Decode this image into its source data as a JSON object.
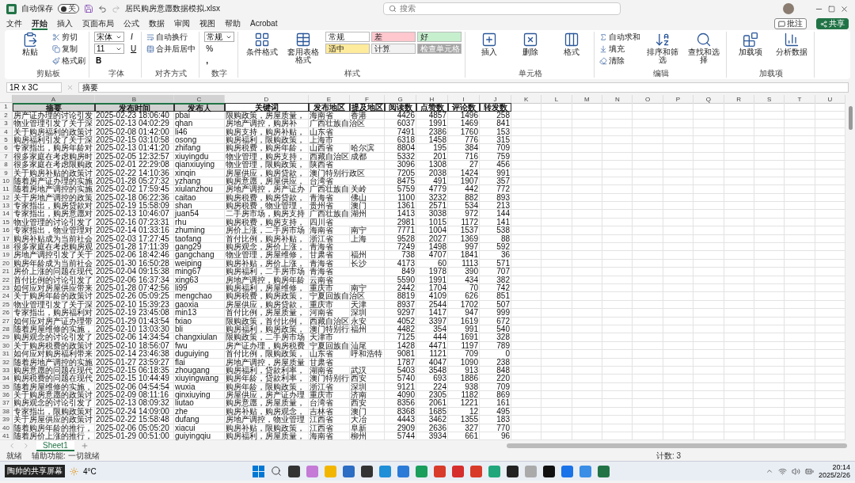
{
  "title_bar": {
    "autosave_label": "自动保存",
    "autosave_on": false,
    "autosave_state": "关",
    "filename": "居民购房意愿数据模拟.xlsx",
    "search_placeholder": "搜索"
  },
  "menu_tabs": [
    {
      "label": "文件",
      "selected": false
    },
    {
      "label": "开始",
      "selected": true
    },
    {
      "label": "插入",
      "selected": false
    },
    {
      "label": "页面布局",
      "selected": false
    },
    {
      "label": "公式",
      "selected": false
    },
    {
      "label": "数据",
      "selected": false
    },
    {
      "label": "审阅",
      "selected": false
    },
    {
      "label": "视图",
      "selected": false
    },
    {
      "label": "帮助",
      "selected": false
    },
    {
      "label": "Acrobat",
      "selected": false
    }
  ],
  "comment_button": "批注",
  "share_button": "共享",
  "ribbon": [
    {
      "title": "剪贴板",
      "items": [
        {
          "kind": "large",
          "label": "粘贴"
        },
        {
          "kind": "small",
          "label": "剪切"
        },
        {
          "kind": "small",
          "label": "复制"
        },
        {
          "kind": "small",
          "label": "格式刷"
        }
      ]
    },
    {
      "title": "字体",
      "items": [
        {
          "kind": "select",
          "value": "宋体"
        },
        {
          "kind": "select",
          "value": "11"
        },
        {
          "kind": "glyph",
          "label": "B"
        },
        {
          "kind": "glyph",
          "label": "I"
        },
        {
          "kind": "glyph",
          "label": "U"
        }
      ]
    },
    {
      "title": "对齐方式",
      "items": [
        {
          "kind": "small",
          "label": "自动换行"
        },
        {
          "kind": "small",
          "label": "合并后居中"
        }
      ]
    },
    {
      "title": "数字",
      "items": [
        {
          "kind": "select",
          "value": "常规"
        },
        {
          "kind": "glyph",
          "label": "%"
        },
        {
          "kind": "glyph",
          "label": ","
        }
      ]
    },
    {
      "title": "样式",
      "items": [
        {
          "kind": "large",
          "label": "条件格式"
        },
        {
          "kind": "large",
          "label": "套用表格格式"
        }
      ],
      "styles": [
        {
          "label": "常规",
          "color": "#ffffff"
        },
        {
          "label": "差",
          "color": "#ffc7ce"
        },
        {
          "label": "好",
          "color": "#c6efce"
        },
        {
          "label": "适中",
          "color": "#ffeb9c"
        },
        {
          "label": "计算",
          "color": "#f2f2f2"
        },
        {
          "label": "检查单元格",
          "color": "#a5a5a5"
        }
      ]
    },
    {
      "title": "单元格",
      "items": [
        {
          "kind": "large",
          "label": "插入"
        },
        {
          "kind": "large",
          "label": "删除"
        },
        {
          "kind": "large",
          "label": "格式"
        }
      ]
    },
    {
      "title": "编辑",
      "items": [
        {
          "kind": "small",
          "label": "自动求和"
        },
        {
          "kind": "small",
          "label": "填充"
        },
        {
          "kind": "small",
          "label": "清除"
        },
        {
          "kind": "large",
          "label": "排序和筛选"
        },
        {
          "kind": "large",
          "label": "查找和选择"
        }
      ]
    },
    {
      "title": "加载项",
      "items": [
        {
          "kind": "large",
          "label": "加载项"
        },
        {
          "kind": "large",
          "label": "分析数据"
        }
      ]
    }
  ],
  "formula_bar": {
    "name_box": "1R x 3C",
    "value": "摘要"
  },
  "sheet": {
    "columns": [
      {
        "label": "A",
        "selected": true
      },
      {
        "label": "B",
        "selected": true
      },
      {
        "label": "C",
        "selected": true
      },
      {
        "label": "D",
        "selected": false
      },
      {
        "label": "E",
        "selected": false
      },
      {
        "label": "F",
        "selected": false
      },
      {
        "label": "G",
        "selected": false
      },
      {
        "label": "H",
        "selected": false
      },
      {
        "label": "I",
        "selected": false
      },
      {
        "label": "J",
        "selected": false
      },
      {
        "label": "K",
        "selected": false
      },
      {
        "label": "L",
        "selected": false
      },
      {
        "label": "M",
        "selected": false
      },
      {
        "label": "N",
        "selected": false
      },
      {
        "label": "O",
        "selected": false
      },
      {
        "label": "P",
        "selected": false
      },
      {
        "label": "Q",
        "selected": false
      },
      {
        "label": "R",
        "selected": false
      },
      {
        "label": "S",
        "selected": false
      },
      {
        "label": "T",
        "selected": false
      },
      {
        "label": "U",
        "selected": false
      }
    ],
    "row_numbers": [
      "1",
      "2",
      "3",
      "4",
      "5",
      "6",
      "7",
      "8",
      "9",
      "10",
      "11",
      "12",
      "13",
      "14",
      "15",
      "16",
      "17",
      "18",
      "19",
      "20",
      "21",
      "22",
      "23",
      "24",
      "25",
      "26",
      "27",
      "28",
      "29",
      "30",
      "31",
      "32",
      "33",
      "34",
      "35",
      "36",
      "37",
      "38",
      "39",
      "40",
      "41"
    ],
    "header": [
      {
        "text": "摘要",
        "selected": true
      },
      {
        "text": "发布时间",
        "selected": true
      },
      {
        "text": "发布人",
        "selected": true
      },
      {
        "text": "关键词",
        "selected": false
      },
      {
        "text": "发布地区",
        "selected": false
      },
      {
        "text": "提及地区",
        "selected": false
      },
      {
        "text": "阅读数",
        "selected": false
      },
      {
        "text": "点赞数",
        "selected": false
      },
      {
        "text": "评论数",
        "selected": false
      },
      {
        "text": "转发数",
        "selected": false
      }
    ],
    "rows": [
      [
        "房产证办理的讨论引发",
        "2025-02-23 18:06:40",
        "pbai",
        "限购政策，房屋质量，",
        "海南省",
        "香港",
        "4426",
        "4857",
        "1496",
        "258"
      ],
      [
        "物业管理引发了关于深",
        "2025-02-13 04:02:29",
        "qhan",
        "房地产调控，购房补",
        "广西壮族自治区",
        "",
        "6037",
        "1991",
        "1469",
        "841"
      ],
      [
        "关于购房福利的政策讨",
        "2025-02-08 01:42:00",
        "li46",
        "购房支持，购房补贴，",
        "山东省",
        "",
        "7491",
        "2386",
        "1760",
        "153"
      ],
      [
        "购房福利引发了关于深",
        "2025-02-15 03:10:58",
        "osong",
        "购房福利，限购政策，",
        "上海市",
        "",
        "6318",
        "1458",
        "776",
        "315"
      ],
      [
        "专家指出，购房年龄对",
        "2025-02-13 01:41:20",
        "zhifang",
        "购房税费，购房年龄，",
        "山西省",
        "哈尔滨",
        "8804",
        "195",
        "384",
        "709"
      ],
      [
        "很多家庭在考虑购房时",
        "2025-02-05 12:32:57",
        "xiuyingdu",
        "物业管理，购房支持，",
        "西藏自治区",
        "成都",
        "5332",
        "201",
        "716",
        "759"
      ],
      [
        "很多家庭在考虑限购政",
        "2025-02-01 22:29:08",
        "qianxiuying",
        "物业管理，限购政策，",
        "陕西省",
        "",
        "3096",
        "1308",
        "27",
        "456"
      ],
      [
        "关于购房补贴的政策讨",
        "2025-02-22 14:10:36",
        "xinqin",
        "房屋供应，购房贷款，",
        "澳门特别行政区",
        "",
        "7205",
        "2038",
        "1424",
        "991"
      ],
      [
        "随着房产证办理的实施",
        "2025-01-28 05:27:32",
        "yzhang",
        "购房意愿，房屋供应，",
        "台湾省",
        "",
        "8475",
        "491",
        "1907",
        "357"
      ],
      [
        "随着房地产调控的实施",
        "2025-02-02 17:59:45",
        "xiulanzhou",
        "房地产调控，房产证办",
        "广西壮族自",
        "关岭",
        "5759",
        "4779",
        "442",
        "772"
      ],
      [
        "关于房地产调控的政策",
        "2025-02-18 06:22:36",
        "caitao",
        "购房税费，购房贷款，",
        "青海省",
        "佛山",
        "1100",
        "3232",
        "882",
        "893"
      ],
      [
        "专家指出，购房贷款对",
        "2025-02-19 15:58:09",
        "shan",
        "购房税费，物业管理，",
        "贵州省",
        "澳门",
        "1361",
        "2571",
        "534",
        "213"
      ],
      [
        "专家指出，购房意愿对",
        "2025-02-13 10:46:07",
        "juan54",
        "二手房市场，购房支持",
        "广西壮族自",
        "湖州",
        "1413",
        "3038",
        "972",
        "144"
      ],
      [
        "物业管理的讨论引发了",
        "2025-02-16 07:23:31",
        "rhu",
        "购房税费，购房支持，",
        "四川省",
        "",
        "2981",
        "1015",
        "1172",
        "141"
      ],
      [
        "专家指出，物业管理对",
        "2025-02-14 01:33:16",
        "zhuming",
        "房价上涨，二手房市场",
        "海南省",
        "南宁",
        "7771",
        "1004",
        "1537",
        "538"
      ],
      [
        "购房补贴成为当前社会",
        "2025-02-03 17:27:45",
        "taofang",
        "首付比例，购房补贴，",
        "浙江省",
        "上海",
        "9528",
        "2027",
        "1369",
        "88"
      ],
      [
        "很多家庭在考虑购房观",
        "2025-01-28 17:11:39",
        "gang29",
        "购房观念，房价上涨，",
        "青海省",
        "",
        "7249",
        "1498",
        "997",
        "592"
      ],
      [
        "房地产调控引发了关于",
        "2025-02-06 18:42:46",
        "gangchang",
        "物业管理，房屋维修，",
        "甘肃省",
        "福州",
        "738",
        "4707",
        "1841",
        "36"
      ],
      [
        "购房年龄成为当前社会",
        "2025-01-30 16:50:28",
        "weiping",
        "购房补贴，房价上涨，",
        "青海省",
        "长沙",
        "4173",
        "60",
        "1113",
        "571"
      ],
      [
        "房价上涨的问题在现代",
        "2025-02-04 09:15:38",
        "ming67",
        "购房福利，二手房市场",
        "青海省",
        "",
        "849",
        "1978",
        "390",
        "707"
      ],
      [
        "首付比例的讨论引发了",
        "2025-02-06 16:37:34",
        "xing63",
        "房地产调控，购房年龄",
        "云南省",
        "",
        "5590",
        "1991",
        "434",
        "382"
      ],
      [
        "如何应对房屋供应带来",
        "2025-01-28 07:42:56",
        "li99",
        "购房福利，房屋维修，",
        "重庆市",
        "南宁",
        "2442",
        "1704",
        "70",
        "742"
      ],
      [
        "关于购房年龄的政策讨",
        "2025-02-26 05:09:25",
        "mengchao",
        "购房税费，购房政策，",
        "宁夏回族自治区",
        "",
        "8819",
        "4109",
        "626",
        "851"
      ],
      [
        "物业管理引发了关于深",
        "2025-02-10 15:39:23",
        "gaoxia",
        "房屋供应，购房贷款，",
        "重庆市",
        "天津",
        "8937",
        "2544",
        "1702",
        "507"
      ],
      [
        "专家指出，购房福利对",
        "2025-02-19 23:45:08",
        "min13",
        "首付比例，房屋质量，",
        "河南省",
        "深圳",
        "9297",
        "1417",
        "947",
        "999"
      ],
      [
        "如何应对房产证办理带",
        "2025-01-29 01:43:54",
        "fxiao",
        "限购政策，首付比例，",
        "西藏自治区",
        "永安",
        "4052",
        "3397",
        "1619",
        "672"
      ],
      [
        "随着房屋维修的实施，",
        "2025-02-10 13:03:30",
        "bli",
        "购房福利，购房政策，",
        "澳门特别行",
        "福州",
        "4482",
        "354",
        "991",
        "540"
      ],
      [
        "购房观念的讨论引发了",
        "2025-02-06 14:34:54",
        "changxiulan",
        "限购政策，二手房市场",
        "天津市",
        "",
        "7125",
        "444",
        "1691",
        "328"
      ],
      [
        "关于购房税费的政策讨",
        "2025-02-10 18:56:07",
        "fwu",
        "房产证办理，购房税费",
        "宁夏回族自",
        "汕尾",
        "1428",
        "4471",
        "1197",
        "789"
      ],
      [
        "如何应对购房福利带来",
        "2025-02-14 23:46:38",
        "duguiying",
        "首付比例，限购政策，",
        "山东省",
        "呼和浩特",
        "9081",
        "1121",
        "709",
        "0"
      ],
      [
        "随着房地产调控的实施",
        "2025-01-27 23:59:27",
        "flai",
        "房地产调控，房屋质量",
        "甘肃省",
        "",
        "1787",
        "4047",
        "1090",
        "238"
      ],
      [
        "购房意愿的问题在现代",
        "2025-02-15 06:18:35",
        "zhougang",
        "购房福利，贷款利率，",
        "湖南省",
        "武汉",
        "5403",
        "3548",
        "913",
        "848"
      ],
      [
        "购房税费的问题在现代",
        "2025-02-15 10:44:49",
        "xiuyingwang",
        "购房年龄，贷款利率，",
        "澳门特别行",
        "西安",
        "5740",
        "693",
        "1886",
        "220"
      ],
      [
        "随着房屋维修的实施，",
        "2025-02-06 04:54:54",
        "wuxia",
        "购房年龄，限购政策，",
        "浙江省",
        "深圳",
        "9121",
        "224",
        "938",
        "709"
      ],
      [
        "关于购房意愿的政策讨",
        "2025-02-09 08:11:16",
        "qinxiuying",
        "房屋供应，房产证办理",
        "重庆市",
        "济南",
        "4090",
        "2305",
        "1182",
        "869"
      ],
      [
        "购房观念的讨论引发了",
        "2025-02-13 08:09:32",
        "liutao",
        "购房意愿，房屋质量，",
        "台湾省",
        "西安",
        "8356",
        "2061",
        "1221",
        "161"
      ],
      [
        "专家指出，限购政策对",
        "2025-02-24 14:09:00",
        "zhe",
        "购房补贴，购房观念，",
        "吉林省",
        "澳门",
        "8368",
        "1685",
        "12",
        "495"
      ],
      [
        "关于房屋供应的政策讨",
        "2025-02-22 15:58:48",
        "dufang",
        "房地产调控，物业管理",
        "江西省",
        "大冶",
        "4443",
        "3462",
        "1355",
        "183"
      ],
      [
        "随着购房年龄的推行，",
        "2025-02-06 05:05:20",
        "xiacui",
        "购房补贴，限购政策，",
        "江西省",
        "阜新",
        "2909",
        "2636",
        "327",
        "770"
      ],
      [
        "随着房价上涨的推行，",
        "2025-01-29 00:51:00",
        "guiyingqiu",
        "购房福利，房屋质量，",
        "海南省",
        "柳州",
        "5744",
        "3934",
        "661",
        "96"
      ]
    ]
  },
  "sheet_tabs": [
    {
      "label": "Sheet1",
      "selected": true
    }
  ],
  "status_bar": {
    "ready": "就绪",
    "accessibility": "辅助功能: 一切就绪",
    "count": "计数: 3"
  },
  "taskbar": {
    "share_label": "陶帅的共享屏幕",
    "weather": "4°C",
    "time": "20:14",
    "date": "2025/2/26"
  }
}
